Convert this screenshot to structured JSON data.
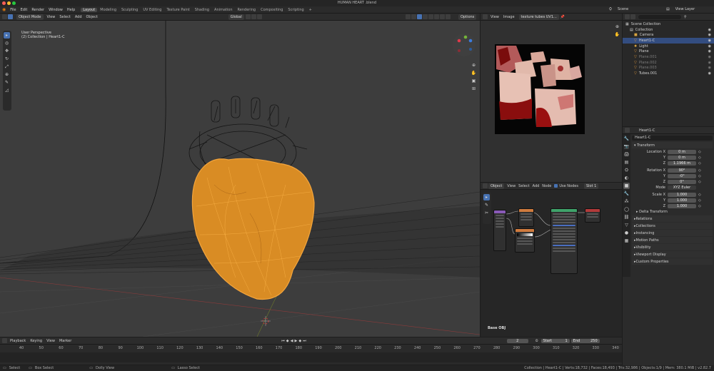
{
  "window": {
    "title": "HUMAN HEART .blend"
  },
  "menu": [
    "File",
    "Edit",
    "Render",
    "Window",
    "Help"
  ],
  "workspaces": [
    "Layout",
    "Modeling",
    "Sculpting",
    "UV Editing",
    "Texture Paint",
    "Shading",
    "Animation",
    "Rendering",
    "Compositing",
    "Scripting",
    "+"
  ],
  "scene": {
    "label": "Scene",
    "view_layer": "View Layer"
  },
  "viewport": {
    "mode": "Object Mode",
    "menus": [
      "View",
      "Select",
      "Add",
      "Object"
    ],
    "transform_orientation": "Global",
    "options_label": "Options",
    "overlay_line1": "User Perspective",
    "overlay_line2": "(2) Collection | Heart1-C"
  },
  "image_editor": {
    "menus": [
      "View",
      "Image"
    ],
    "image_name": "texture tubes UV1..."
  },
  "node_editor": {
    "object_label": "Object",
    "menus": [
      "View",
      "Select",
      "Add",
      "Node"
    ],
    "use_nodes": "Use Nodes",
    "slot": "Slot 1",
    "material_label": "Base OBJ"
  },
  "outliner": {
    "rows": [
      {
        "label": "Scene Collection",
        "indent": 0,
        "icon": "scene-collection-icon",
        "selected": false,
        "dim": false
      },
      {
        "label": "Collection",
        "indent": 1,
        "icon": "collection-icon",
        "selected": false,
        "dim": false
      },
      {
        "label": "Camera",
        "indent": 2,
        "icon": "camera-icon",
        "selected": false,
        "dim": false
      },
      {
        "label": "Heart1-C",
        "indent": 2,
        "icon": "mesh-icon",
        "selected": true,
        "dim": false
      },
      {
        "label": "Light",
        "indent": 2,
        "icon": "light-icon",
        "selected": false,
        "dim": false
      },
      {
        "label": "Plane",
        "indent": 2,
        "icon": "mesh-icon",
        "selected": false,
        "dim": false
      },
      {
        "label": "Plane.001",
        "indent": 2,
        "icon": "mesh-icon",
        "selected": false,
        "dim": true
      },
      {
        "label": "Plane.002",
        "indent": 2,
        "icon": "mesh-icon",
        "selected": false,
        "dim": true
      },
      {
        "label": "Plane.003",
        "indent": 2,
        "icon": "mesh-icon",
        "selected": false,
        "dim": true
      },
      {
        "label": "Tubes.001",
        "indent": 2,
        "icon": "mesh-icon",
        "selected": false,
        "dim": false
      }
    ]
  },
  "properties": {
    "object_name": "Heart1-C",
    "transform_header": "Transform",
    "location": {
      "label": "Location X",
      "x": "0 m",
      "y": "0 m",
      "z": "1.1966 m"
    },
    "rotation": {
      "label": "Rotation X",
      "x": "90°",
      "y": "-0°",
      "z": "0°"
    },
    "mode": {
      "label": "Mode",
      "value": "XYZ Euler"
    },
    "scale": {
      "label": "Scale X",
      "x": "1.000",
      "y": "1.000",
      "z": "1.000"
    },
    "axis_y": "Y",
    "axis_z": "Z",
    "delta": "Delta Transform",
    "panels": [
      "Relations",
      "Collections",
      "Instancing",
      "Motion Paths",
      "Visibility",
      "Viewport Display",
      "Custom Properties"
    ]
  },
  "timeline": {
    "menus": [
      "Playback",
      "Keying",
      "View",
      "Marker"
    ],
    "current_frame": "2",
    "start_label": "Start",
    "start": "1",
    "end_label": "End",
    "end": "250",
    "ticks": [
      "40",
      "50",
      "60",
      "70",
      "80",
      "90",
      "100",
      "110",
      "120",
      "130",
      "140",
      "150",
      "160",
      "170",
      "180",
      "190",
      "200",
      "210",
      "220",
      "230",
      "240",
      "250",
      "260",
      "270",
      "280",
      "290",
      "300",
      "310",
      "320",
      "330",
      "340"
    ]
  },
  "statusbar": {
    "left": [
      "Select",
      "Box Select",
      "Dolly View",
      "Lasso Select"
    ],
    "right": "Collection | Heart1-C | Verts:18,732 | Faces:18,493 | Tris:32,986 | Objects:1/9 | Mem: 380.1 MiB | v2.82.7"
  }
}
